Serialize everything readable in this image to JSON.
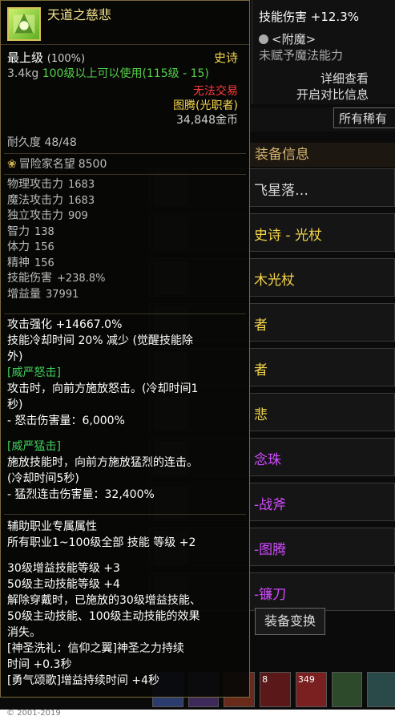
{
  "tooltip": {
    "item_name": "天道之慈悲",
    "grade_label": "最上级",
    "grade_pct": "(100%)",
    "rarity": "史诗",
    "weight": "3.4kg",
    "level_req": "100级以上可以使用(115级 - 15)",
    "trade": "无法交易",
    "job": "图腾(光职者)",
    "price": "34,848金币",
    "durability_label": "耐久度",
    "durability_value": "48/48",
    "fame_label": "冒险家名望",
    "fame_value": "8500",
    "stats": [
      {
        "label": "物理攻击力",
        "value": "1683"
      },
      {
        "label": "魔法攻击力",
        "value": "1683"
      },
      {
        "label": "独立攻击力",
        "value": "909"
      },
      {
        "label": "智力",
        "value": "138"
      },
      {
        "label": "体力",
        "value": "156"
      },
      {
        "label": "精神",
        "value": "156"
      },
      {
        "label": "技能伤害",
        "value": "+238.8%"
      },
      {
        "label": "增益量",
        "value": "37991"
      }
    ],
    "attack_boost": "攻击强化 +14667.0%",
    "cooldown_line1": "技能冷却时间 20% 减少 (觉醒技能除",
    "cooldown_line2": "外)",
    "wrath_title": "[威严怒击]",
    "wrath_desc1": "攻击时，向前方施放怒击。(冷却时间1",
    "wrath_desc2": "秒)",
    "wrath_dmg": "- 怒击伤害量：6,000%",
    "fierce_title": "[威严猛击]",
    "fierce_desc1": "施放技能时，向前方施放猛烈的连击。",
    "fierce_desc2": "(冷却时间5秒)",
    "fierce_dmg": "- 猛烈连击伤害量：32,400%",
    "support_title": "辅助职业专属属性",
    "support_line": "所有职业1~100级全部 技能 等级 +2",
    "buff_lv30": "30级增益技能等级 +3",
    "active_lv50": "50级主动技能等级 +4",
    "unequip1": "解除穿戴时，已施放的30级增益技能、",
    "unequip2": "50级主动技能、100级主动技能的效果",
    "unequip3": "消失。",
    "baptism1": "[神圣洗礼：信仰之翼]神圣之力持续",
    "baptism2": "时间 +0.3秒",
    "courage": "[勇气颂歌]增益持续时间 +4秒"
  },
  "background": {
    "skill_damage": "技能伤害 +12.3%",
    "enchant": "<附魔>",
    "no_enchant": "未赋予魔法能力",
    "detail_view": "详细查看",
    "compare_on": "开启对比信息",
    "filter_all": "所有稀有",
    "equip_info": "装备信息",
    "rows": [
      {
        "text": "飞星落…",
        "color": "#d8d8d8"
      },
      {
        "text": "史诗 - 光杖",
        "color": "#f2d34a"
      },
      {
        "text": "木光杖",
        "color": "#f2d34a"
      },
      {
        "text": "者",
        "color": "#f2d34a"
      },
      {
        "text": "者",
        "color": "#f2d34a"
      },
      {
        "text": "悲",
        "color": "#f2d34a"
      },
      {
        "text": "念珠",
        "color": "#d14bff"
      },
      {
        "text": "-战斧",
        "color": "#d14bff"
      },
      {
        "text": "-图腾",
        "color": "#d14bff"
      },
      {
        "text": "-镰刀",
        "color": "#d14bff"
      }
    ],
    "swap": "装备变换",
    "skills": [
      "",
      "",
      "",
      "8",
      "349",
      "",
      ""
    ],
    "copyright": "© 2001-2019"
  },
  "colors": {
    "epic": "#f2d34a",
    "green": "#3fd05a",
    "red": "#ff3a3a",
    "purple": "#d14bff"
  },
  "icons": {
    "item": "item-icon",
    "medal": "medal-icon",
    "dropdown": "dropdown-arrow-icon"
  }
}
